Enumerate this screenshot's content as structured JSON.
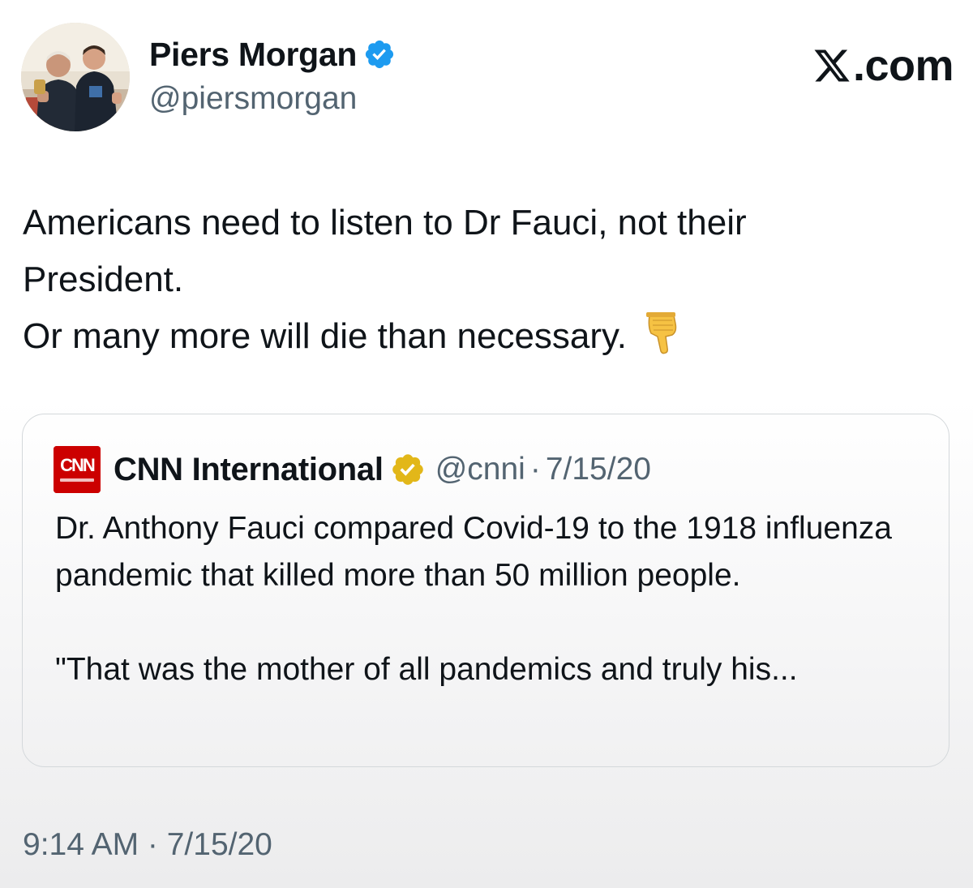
{
  "author": {
    "name": "Piers Morgan",
    "handle": "@piersmorgan",
    "avatar_icon": "profile-photo-two-men",
    "verified_color": "#1d9bf0"
  },
  "site_logo": {
    "text": ".com",
    "icon": "x-logo-icon"
  },
  "tweet": {
    "lines": [
      "Americans need to listen to Dr Fauci, not their",
      "President.",
      "Or many more will die than necessary."
    ],
    "emoji_icon": "backhand-index-pointing-down-icon"
  },
  "quote": {
    "logo_icon": "cnn-international-logo",
    "name": "CNN International",
    "handle": "@cnni",
    "separator": "·",
    "date": "7/15/20",
    "badge_color": "#e2b719",
    "paragraph1": "Dr. Anthony Fauci compared Covid-19 to the 1918 influenza pandemic that killed more than 50 million people.",
    "paragraph2": "\"That was the mother of all pandemics and truly his..."
  },
  "timestamp": "9:14 AM · 7/15/20",
  "colors": {
    "text": "#0f1419",
    "secondary": "#536471",
    "border": "#d4d8db",
    "cnn_red": "#cc0000"
  }
}
